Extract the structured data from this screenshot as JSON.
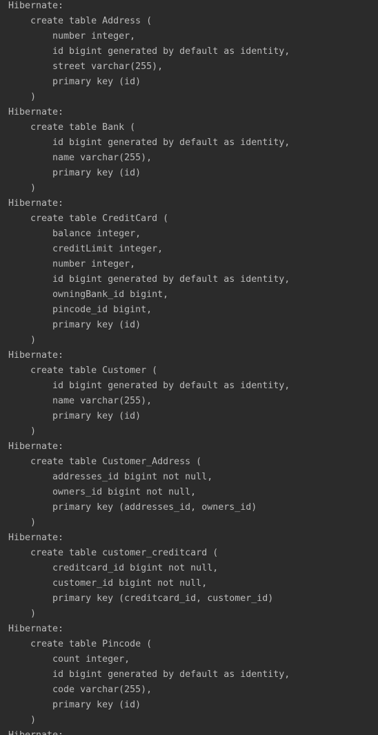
{
  "console": {
    "lines": [
      "Hibernate:",
      "    create table Address (",
      "        number integer,",
      "        id bigint generated by default as identity,",
      "        street varchar(255),",
      "        primary key (id)",
      "    )",
      "Hibernate:",
      "    create table Bank (",
      "        id bigint generated by default as identity,",
      "        name varchar(255),",
      "        primary key (id)",
      "    )",
      "Hibernate:",
      "    create table CreditCard (",
      "        balance integer,",
      "        creditLimit integer,",
      "        number integer,",
      "        id bigint generated by default as identity,",
      "        owningBank_id bigint,",
      "        pincode_id bigint,",
      "        primary key (id)",
      "    )",
      "Hibernate:",
      "    create table Customer (",
      "        id bigint generated by default as identity,",
      "        name varchar(255),",
      "        primary key (id)",
      "    )",
      "Hibernate:",
      "    create table Customer_Address (",
      "        addresses_id bigint not null,",
      "        owners_id bigint not null,",
      "        primary key (addresses_id, owners_id)",
      "    )",
      "Hibernate:",
      "    create table customer_creditcard (",
      "        creditcard_id bigint not null,",
      "        customer_id bigint not null,",
      "        primary key (creditcard_id, customer_id)",
      "    )",
      "Hibernate:",
      "    create table Pincode (",
      "        count integer,",
      "        id bigint generated by default as identity,",
      "        code varchar(255),",
      "        primary key (id)",
      "    )",
      "Hibernate:"
    ]
  }
}
